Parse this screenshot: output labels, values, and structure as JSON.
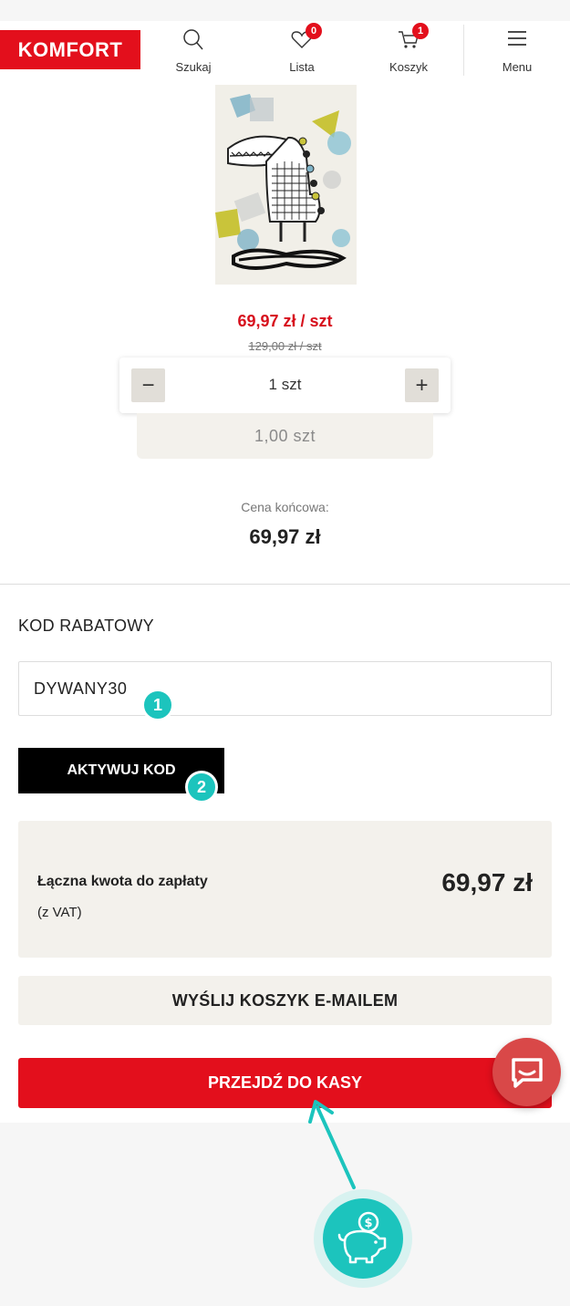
{
  "header": {
    "logo": "KOMFORT",
    "search_label": "Szukaj",
    "wishlist_label": "Lista",
    "wishlist_count": "0",
    "cart_label": "Koszyk",
    "cart_count": "1",
    "menu_label": "Menu"
  },
  "product": {
    "price_new": "69,97 zł / szt",
    "price_old": "129,00 zł / szt",
    "quantity": "1 szt",
    "quantity_total": "1,00 szt",
    "final_label": "Cena końcowa:",
    "final_price": "69,97 zł"
  },
  "discount": {
    "title": "KOD RABATOWY",
    "code_value": "DYWANY30",
    "activate_label": "AKTYWUJ KOD",
    "step1": "1",
    "step2": "2"
  },
  "summary": {
    "label": "Łączna kwota do zapłaty",
    "vat": "(z VAT)",
    "total": "69,97 zł"
  },
  "actions": {
    "email_label": "WYŚLIJ KOSZYK E-MAILEM",
    "checkout_label": "PRZEJDŹ DO KASY"
  },
  "colors": {
    "brand_red": "#e30f1c",
    "teal_accent": "#1cc4bd",
    "panel_beige": "#f3f1ec"
  }
}
